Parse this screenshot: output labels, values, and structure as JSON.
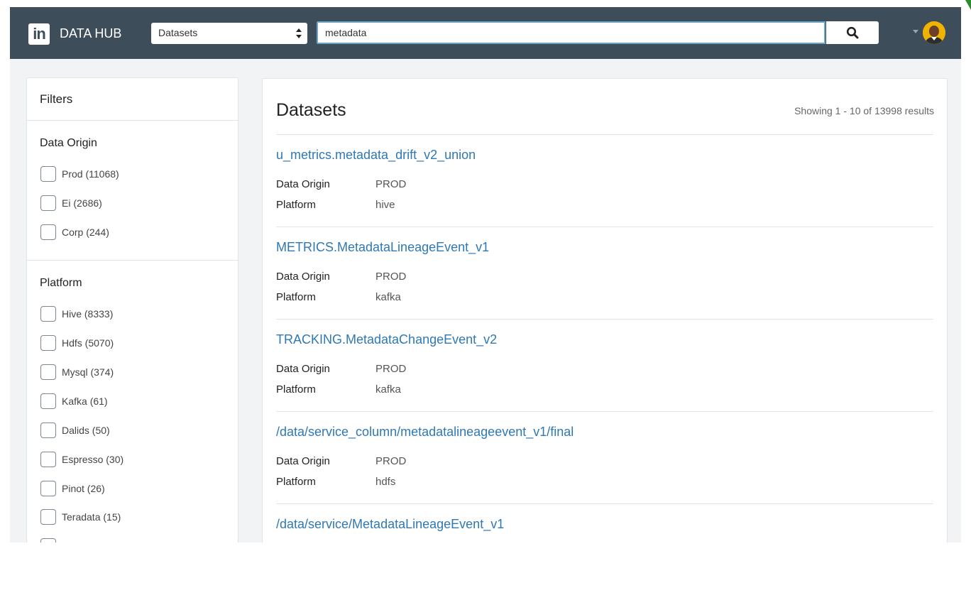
{
  "header": {
    "logo_text": "in",
    "brand_name": "DATA HUB",
    "entity_select": {
      "selected": "Datasets"
    },
    "search": {
      "value": "metadata",
      "button_icon": "search-icon"
    },
    "user": {
      "menu_icon": "caret-down-icon",
      "avatar_icon": "avatar"
    }
  },
  "filters": {
    "title": "Filters",
    "groups": [
      {
        "title": "Data Origin",
        "options": [
          {
            "label": "Prod (11068)",
            "checked": false
          },
          {
            "label": "Ei (2686)",
            "checked": false
          },
          {
            "label": "Corp (244)",
            "checked": false
          }
        ]
      },
      {
        "title": "Platform",
        "options": [
          {
            "label": "Hive (8333)",
            "checked": false
          },
          {
            "label": "Hdfs (5070)",
            "checked": false
          },
          {
            "label": "Mysql (374)",
            "checked": false
          },
          {
            "label": "Kafka (61)",
            "checked": false
          },
          {
            "label": "Dalids (50)",
            "checked": false
          },
          {
            "label": "Espresso (30)",
            "checked": false
          },
          {
            "label": "Pinot (26)",
            "checked": false
          },
          {
            "label": "Teradata (15)",
            "checked": false
          }
        ]
      }
    ]
  },
  "results": {
    "title": "Datasets",
    "summary": "Showing 1 - 10 of 13998 results",
    "items": [
      {
        "name": "u_metrics.metadata_drift_v2_union",
        "origin_label": "Data Origin",
        "origin": "PROD",
        "platform_label": "Platform",
        "platform": "hive"
      },
      {
        "name": "METRICS.MetadataLineageEvent_v1",
        "origin_label": "Data Origin",
        "origin": "PROD",
        "platform_label": "Platform",
        "platform": "kafka"
      },
      {
        "name": "TRACKING.MetadataChangeEvent_v2",
        "origin_label": "Data Origin",
        "origin": "PROD",
        "platform_label": "Platform",
        "platform": "kafka"
      },
      {
        "name": "/data/service_column/metadatalineageevent_v1/final",
        "origin_label": "Data Origin",
        "origin": "PROD",
        "platform_label": "Platform",
        "platform": "hdfs"
      },
      {
        "name": "/data/service/MetadataLineageEvent_v1",
        "origin_label": "",
        "origin": "",
        "platform_label": "",
        "platform": ""
      }
    ]
  },
  "colors": {
    "navbar": "#3e4d5a",
    "link": "#2f78b4",
    "search_border": "#6ba4c5",
    "background": "#f2f3f4"
  }
}
